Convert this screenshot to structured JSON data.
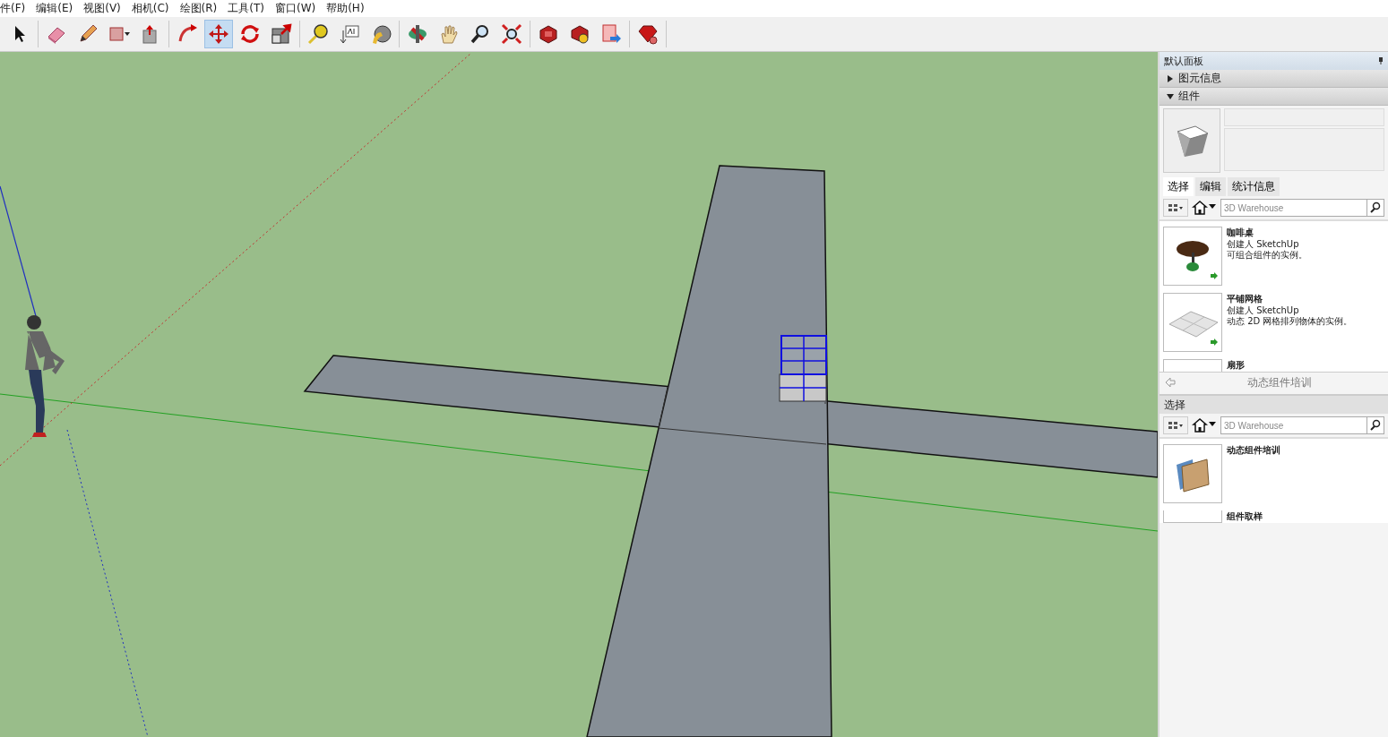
{
  "menu_bar": {
    "items": [
      "件(F)",
      "编辑(E)",
      "视图(V)",
      "相机(C)",
      "绘图(R)",
      "工具(T)",
      "窗口(W)",
      "帮助(H)"
    ]
  },
  "toolbar": {
    "groups": [
      [
        {
          "kind": "select",
          "selected": false
        }
      ],
      [
        {
          "kind": "eraser",
          "selected": false
        },
        {
          "kind": "pencil",
          "selected": false
        },
        {
          "kind": "rectangle",
          "selected": false
        },
        {
          "kind": "pushpull",
          "selected": false
        }
      ],
      [
        {
          "kind": "followme",
          "selected": false
        },
        {
          "kind": "move",
          "selected": true
        },
        {
          "kind": "rotate",
          "selected": false
        },
        {
          "kind": "scale",
          "selected": false
        }
      ],
      [
        {
          "kind": "tape",
          "selected": false
        },
        {
          "kind": "text",
          "selected": false
        },
        {
          "kind": "paint",
          "selected": false
        }
      ],
      [
        {
          "kind": "orbit",
          "selected": false
        },
        {
          "kind": "pan",
          "selected": false
        },
        {
          "kind": "zoom",
          "selected": false
        },
        {
          "kind": "extents",
          "selected": false
        }
      ],
      [
        {
          "kind": "warehouse",
          "selected": false
        },
        {
          "kind": "share",
          "selected": false
        },
        {
          "kind": "send",
          "selected": false
        }
      ],
      [
        {
          "kind": "ruby",
          "selected": false
        }
      ]
    ]
  },
  "tray": {
    "title": "默认面板",
    "sections": [
      {
        "label": "图元信息",
        "expanded": false
      },
      {
        "label": "组件",
        "expanded": true
      }
    ],
    "tabs": [
      {
        "label": "选择",
        "selected": true
      },
      {
        "label": "编辑",
        "selected": false
      },
      {
        "label": "统计信息",
        "selected": false
      }
    ],
    "search": {
      "placeholder": "3D Warehouse"
    },
    "components": [
      {
        "kind": "table",
        "name": "咖啡桌",
        "author": "创建人 SketchUp",
        "description": "可组合组件的实例。"
      },
      {
        "kind": "grid",
        "name": "平铺网格",
        "author": "创建人 SketchUp",
        "description": "动态 2D 网格排列物体的实例。"
      },
      {
        "kind": "blank",
        "name": "扇形"
      }
    ],
    "nav_title": "动态组件培训",
    "secondary": {
      "header": "选择",
      "search": {
        "placeholder": "3D Warehouse"
      },
      "components": [
        {
          "kind": "folder",
          "name": "动态组件培训"
        },
        {
          "kind": "blank",
          "name": "组件取样"
        }
      ]
    }
  }
}
